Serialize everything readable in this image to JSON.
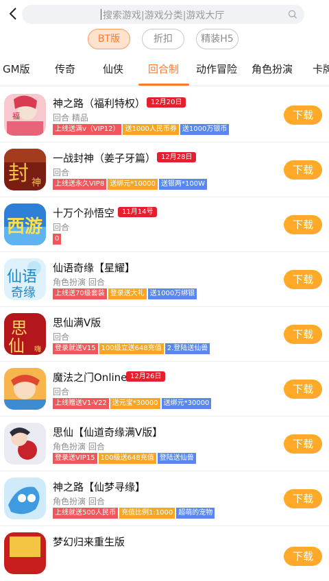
{
  "search": {
    "placeholder": "搜索游戏|游戏分类|游戏大厅"
  },
  "chips": [
    {
      "label": "BT版",
      "active": true
    },
    {
      "label": "折扣",
      "active": false
    },
    {
      "label": "精装H5",
      "active": false
    }
  ],
  "tabs": [
    {
      "label": "GM版"
    },
    {
      "label": "传奇"
    },
    {
      "label": "仙侠"
    },
    {
      "label": "回合制",
      "active": true
    },
    {
      "label": "动作冒险"
    },
    {
      "label": "角色扮演"
    },
    {
      "label": "卡牌"
    }
  ],
  "download_label": "下载",
  "colors": {
    "accent": "#ff7a2e",
    "download": "#ffa92a",
    "date_badge": "#e3202b",
    "tag_red": "#f2555b",
    "tag_orange": "#f9a524",
    "tag_blue": "#5a86f0"
  },
  "games": [
    {
      "title": "神之路（福利特权）",
      "date": "12月20日",
      "sub": "回合 精品",
      "tags": [
        {
          "text": "上线送满v（VIP12）",
          "color": "red"
        },
        {
          "text": "送1000人民币券",
          "color": "orange"
        },
        {
          "text": "送1000万银币",
          "color": "blue"
        }
      ]
    },
    {
      "title": "一战封神（姜子牙篇）",
      "date": "12月28日",
      "sub": "回合",
      "tags": [
        {
          "text": "上线送永久VIP8",
          "color": "red"
        },
        {
          "text": "送绑元*10000",
          "color": "orange"
        },
        {
          "text": "送银两*100W",
          "color": "blue"
        }
      ]
    },
    {
      "title": "十万个孙悟空",
      "date": "11月14号",
      "sub": "回合",
      "tags": [
        {
          "text": "0",
          "color": "red"
        }
      ]
    },
    {
      "title": "仙语奇缘【星耀】",
      "date": "",
      "sub": "角色扮演 回合",
      "tags": [
        {
          "text": "上线送70级套装",
          "color": "red"
        },
        {
          "text": "登录送大礼",
          "color": "orange"
        },
        {
          "text": "送1000万绑银",
          "color": "blue"
        }
      ]
    },
    {
      "title": "思仙满V版",
      "date": "",
      "sub": "回合",
      "tags": [
        {
          "text": "登录就送V15",
          "color": "red"
        },
        {
          "text": "100级立送648充值",
          "color": "orange"
        },
        {
          "text": "2.登陆送仙兽",
          "color": "blue"
        }
      ]
    },
    {
      "title": "魔法之门Online",
      "date": "12月26日",
      "sub": "回合",
      "tags": [
        {
          "text": "上线赠送V1-V22",
          "color": "red"
        },
        {
          "text": "送元宝*30000",
          "color": "orange"
        },
        {
          "text": "送绑元*30000",
          "color": "blue"
        }
      ]
    },
    {
      "title": "思仙【仙道奇缘满V版】",
      "date": "",
      "sub": "角色扮演 回合",
      "tags": [
        {
          "text": "登录送VIP15",
          "color": "red"
        },
        {
          "text": "100级送648充值",
          "color": "orange"
        },
        {
          "text": "登陆送仙兽",
          "color": "blue"
        }
      ]
    },
    {
      "title": "神之路【仙梦寻缘】",
      "date": "",
      "sub": "角色扮演 回合",
      "tags": [
        {
          "text": "上线就送500人民币",
          "color": "red"
        },
        {
          "text": "充值比例1:1000",
          "color": "orange"
        },
        {
          "text": "超萌的宠物",
          "color": "blue"
        }
      ]
    },
    {
      "title": "梦幻归来重生版",
      "date": "",
      "sub": "",
      "tags": []
    }
  ]
}
